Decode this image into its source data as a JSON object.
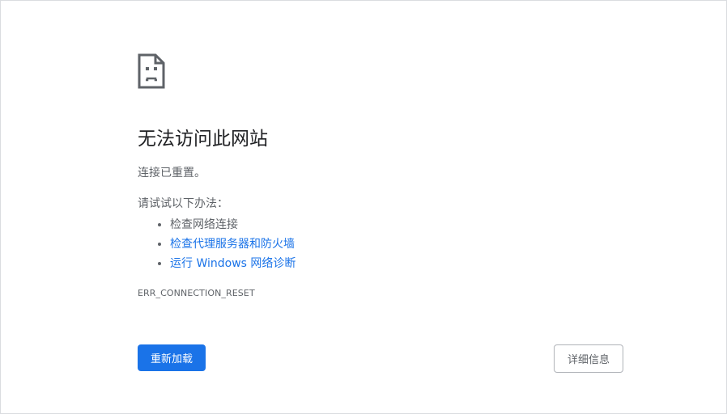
{
  "error_page": {
    "icon": "sad-document-icon",
    "title": "无法访问此网站",
    "subtitle": "连接已重置。",
    "try_label": "请试试以下办法：",
    "suggestions": [
      {
        "label": "检查网络连接",
        "is_link": false
      },
      {
        "label": "检查代理服务器和防火墙",
        "is_link": true
      },
      {
        "label": "运行 Windows 网络诊断",
        "is_link": true
      }
    ],
    "error_code": "ERR_CONNECTION_RESET"
  },
  "buttons": {
    "reload_label": "重新加载",
    "details_label": "详细信息"
  },
  "colors": {
    "accent": "#1a73e8",
    "text_primary": "#202124",
    "text_secondary": "#5f6368"
  }
}
